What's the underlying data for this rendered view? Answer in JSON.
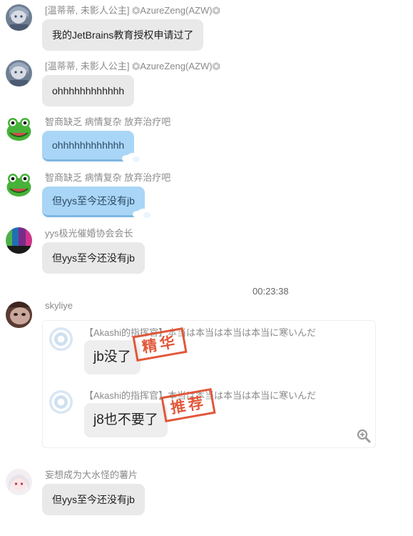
{
  "messages": [
    {
      "sender": "[温蒂蒂, 未影人公主] ⏣AzureZeng(AZW)⏣",
      "text": "我的JetBrains教育授权申请过了"
    },
    {
      "sender": "[温蒂蒂, 未影人公主] ⏣AzureZeng(AZW)⏣",
      "text": "ohhhhhhhhhhhh"
    },
    {
      "sender": "智商缺乏 病情复杂 放弃治疗吧",
      "text": "ohhhhhhhhhhhh"
    },
    {
      "sender": "智商缺乏 病情复杂 放弃治疗吧",
      "text": "但yys至今还没有jb"
    },
    {
      "sender": "yys极光催婚协会会长",
      "text": "但yys至今还没有jb"
    }
  ],
  "timestamp": "00:23:38",
  "skyliye": {
    "sender": "skyliye",
    "forwarded": [
      {
        "header": "【Akashi的指挥官】本当は本当は本当は本当に寒いんだ",
        "text": "jb没了",
        "stamp": "精华"
      },
      {
        "header": "【Akashi的指挥官】本当は本当は本当は本当に寒いんだ",
        "text": "j8也不要了",
        "stamp": "推荐"
      }
    ]
  },
  "last": {
    "sender": "妄想成为大水怪的薯片",
    "text": "但yys至今还没有jb"
  },
  "colors": {
    "blue_bubble": "#a9d6f6",
    "gray_bubble": "#e9e9e9",
    "stamp": "#e04a2a"
  },
  "icons": [
    "anime-avatar",
    "frog-avatar",
    "color-bars-avatar",
    "cat-avatar",
    "white-hair-avatar",
    "zoom-in-icon"
  ]
}
